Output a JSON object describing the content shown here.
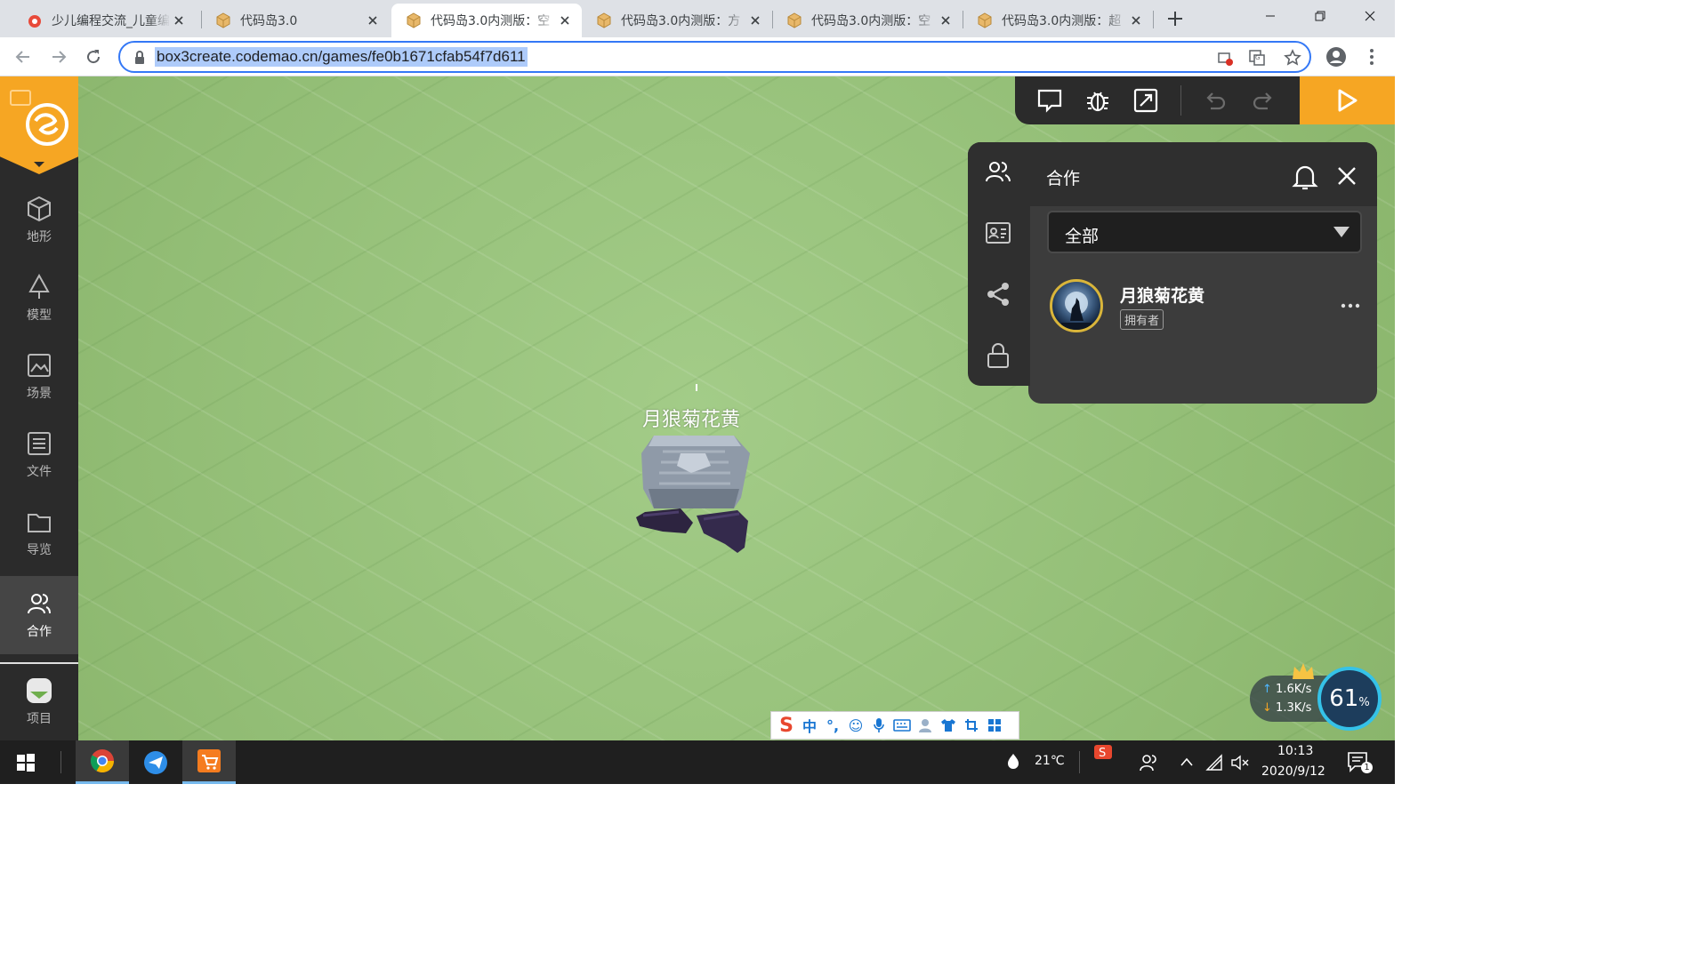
{
  "browser": {
    "tabs": [
      {
        "title": "少儿编程交流_儿童编程",
        "icon": "codemao-favicon",
        "active": false
      },
      {
        "title": "代码岛3.0",
        "icon": "box3-favicon",
        "active": false
      },
      {
        "title": "代码岛3.0内测版：空",
        "icon": "box3-favicon",
        "active": true
      },
      {
        "title": "代码岛3.0内测版：方",
        "icon": "box3-favicon",
        "active": false
      },
      {
        "title": "代码岛3.0内测版：空",
        "icon": "box3-favicon",
        "active": false
      },
      {
        "title": "代码岛3.0内测版：超",
        "icon": "box3-favicon",
        "active": false
      }
    ],
    "url": "box3create.codemao.cn/games/fe0b1671cfab54f7d611"
  },
  "sidebar": {
    "items": [
      {
        "label": "地形",
        "icon": "cube-icon"
      },
      {
        "label": "模型",
        "icon": "tree-icon"
      },
      {
        "label": "场景",
        "icon": "image-icon"
      },
      {
        "label": "文件",
        "icon": "list-icon"
      },
      {
        "label": "导览",
        "icon": "folder-icon"
      },
      {
        "label": "合作",
        "icon": "users-icon"
      },
      {
        "label": "项目",
        "icon": "project-icon"
      }
    ],
    "active": "合作"
  },
  "collab_panel": {
    "title": "合作",
    "filter": "全部",
    "members": [
      {
        "name": "月狼菊花黄",
        "role": "拥有者"
      }
    ]
  },
  "scene": {
    "player_label": "月狼菊花黄"
  },
  "ime": {
    "mode": "中",
    "punct": "°,"
  },
  "network": {
    "up": "1.6K/s",
    "down": "1.3K/s",
    "percent": "61",
    "percent_unit": "%"
  },
  "taskbar": {
    "temperature": "21℃",
    "time": "10:13",
    "date": "2020/9/12",
    "notifications": "1"
  },
  "colors": {
    "accent": "#f6a623",
    "panel": "#3c3c3c",
    "sidebar": "#2b2b2b",
    "ground": "#97c27b"
  }
}
